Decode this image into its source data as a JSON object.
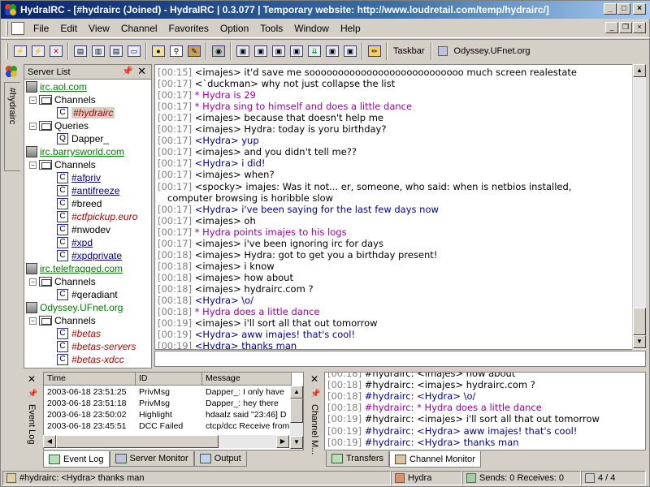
{
  "window": {
    "title": "HydraIRC - [#hydrairc (Joined) - HydraIRC | 0.3.077 | Temporary website: http://www.loudretail.com/temp/hydrairc/]"
  },
  "menu": [
    "File",
    "Edit",
    "View",
    "Channel",
    "Favorites",
    "Option",
    "Tools",
    "Window",
    "Help"
  ],
  "toolbar": {
    "taskbar_label": "Taskbar",
    "server_label": "Odyssey.UFnet.org"
  },
  "sidebar_tab": "#hydrairc",
  "server_list": {
    "title": "Server List",
    "servers": [
      {
        "name": "irc.aol.com",
        "groups": [
          {
            "label": "Channels",
            "items": [
              "#hydrairc"
            ]
          },
          {
            "label": "Queries",
            "items": [
              "Dapper_"
            ]
          }
        ]
      },
      {
        "name": "irc.barrysworld.com",
        "groups": [
          {
            "label": "Channels",
            "items": [
              "#afpriv",
              "#antifreeze",
              "#breed",
              "#ctfpickup.euro",
              "#nwodev",
              "#xpd",
              "#xpdprivate"
            ]
          }
        ]
      },
      {
        "name": "irc.telefragged.com",
        "groups": [
          {
            "label": "Channels",
            "items": [
              "#qeradiant"
            ]
          }
        ]
      },
      {
        "name": "Odyssey.UFnet.org",
        "groups": [
          {
            "label": "Channels",
            "items": [
              "#betas",
              "#betas-servers",
              "#betas-xdcc"
            ]
          }
        ]
      }
    ]
  },
  "chat": [
    {
      "t": "[00:15]",
      "s": "<imajes> it'd save me sooooooooooooooooooooooooooo much screen realestate",
      "k": "n"
    },
    {
      "t": "[00:17]",
      "s": "<`duckman> why not just collapse the list",
      "k": "n"
    },
    {
      "t": "[00:17]",
      "s": "* Hydra is 29",
      "k": "a"
    },
    {
      "t": "[00:17]",
      "s": "* Hydra sing to himself and does a little dance",
      "k": "a"
    },
    {
      "t": "[00:17]",
      "s": "<imajes> because that doesn't help me",
      "k": "n"
    },
    {
      "t": "[00:17]",
      "s": "<imajes> Hydra: today is yoru birthday?",
      "k": "n"
    },
    {
      "t": "[00:17]",
      "s": "<Hydra> yup",
      "k": "s"
    },
    {
      "t": "[00:17]",
      "s": "<imajes> and you didn't tell me??",
      "k": "n"
    },
    {
      "t": "[00:17]",
      "s": "<Hydra> i did!",
      "k": "s"
    },
    {
      "t": "[00:17]",
      "s": "<imajes> when?",
      "k": "n"
    },
    {
      "t": "[00:17]",
      "s": "<spocky> imajes: Was it not... er, someone, who said: when is netbios installed,",
      "k": "n"
    },
    {
      "t": "",
      "s": "computer browsing is horibble slow",
      "k": "n"
    },
    {
      "t": "[00:17]",
      "s": "<Hydra> i've been saying for the last few days now",
      "k": "s"
    },
    {
      "t": "[00:17]",
      "s": "<imajes> oh",
      "k": "n"
    },
    {
      "t": "[00:17]",
      "s": "* Hydra points imajes to his logs",
      "k": "a"
    },
    {
      "t": "[00:17]",
      "s": "<imajes> i've been ignoring irc for days",
      "k": "n"
    },
    {
      "t": "[00:18]",
      "s": "<imajes> Hydra: got to get you a birthday present!",
      "k": "n"
    },
    {
      "t": "[00:18]",
      "s": "<imajes> i know",
      "k": "n"
    },
    {
      "t": "[00:18]",
      "s": "<imajes> how about",
      "k": "n"
    },
    {
      "t": "[00:18]",
      "s": "<imajes> hydrairc.com ?",
      "k": "n"
    },
    {
      "t": "[00:18]",
      "s": "<Hydra> \\o/",
      "k": "s"
    },
    {
      "t": "[00:18]",
      "s": "* Hydra does a little dance",
      "k": "a"
    },
    {
      "t": "[00:19]",
      "s": "<imajes> i'll sort all that out tomorrow",
      "k": "n"
    },
    {
      "t": "[00:19]",
      "s": "<Hydra> aww imajes! that's cool!",
      "k": "s"
    },
    {
      "t": "[00:19]",
      "s": "<Hydra> thanks man",
      "k": "s"
    }
  ],
  "event_log": {
    "side_label": "Event Log",
    "columns": [
      "Time",
      "ID",
      "Message"
    ],
    "rows": [
      [
        "2003-06-18 23:51:25",
        "PrivMsg",
        "Dapper_: I only have"
      ],
      [
        "2003-06-18 23:51:18",
        "PrivMsg",
        "Dapper_: hey there"
      ],
      [
        "2003-06-18 23:50:02",
        "Highlight",
        "hdaalz said \"23:46] D"
      ],
      [
        "2003-06-18 23:45:51",
        "DCC Failed",
        "ctcp/dcc Receive from"
      ]
    ]
  },
  "bottom_tabs_left": [
    "Event Log",
    "Server Monitor",
    "Output"
  ],
  "channel_monitor": {
    "side_label": "Channel M...",
    "lines": [
      {
        "t": "[00:18]",
        "s": "#hydrairc: <imajes> how about",
        "k": "n"
      },
      {
        "t": "[00:18]",
        "s": "#hydrairc: <imajes> hydrairc.com ?",
        "k": "n"
      },
      {
        "t": "[00:18]",
        "s": "#hydrairc: <Hydra> \\o/",
        "k": "s"
      },
      {
        "t": "[00:18]",
        "s": "#hydrairc: * Hydra does a little dance",
        "k": "a"
      },
      {
        "t": "[00:19]",
        "s": "#hydrairc: <imajes> i'll sort all that out tomorrow",
        "k": "n"
      },
      {
        "t": "[00:19]",
        "s": "#hydrairc: <Hydra> aww imajes! that's cool!",
        "k": "s"
      },
      {
        "t": "[00:19]",
        "s": "#hydrairc: <Hydra> thanks man",
        "k": "s"
      }
    ]
  },
  "bottom_tabs_right": [
    "Transfers",
    "Channel Monitor"
  ],
  "status": {
    "last": "#hydrairc: <Hydra> thanks man",
    "nick": "Hydra",
    "sends": "Sends: 0 Receives: 0",
    "count": "4 / 4"
  }
}
